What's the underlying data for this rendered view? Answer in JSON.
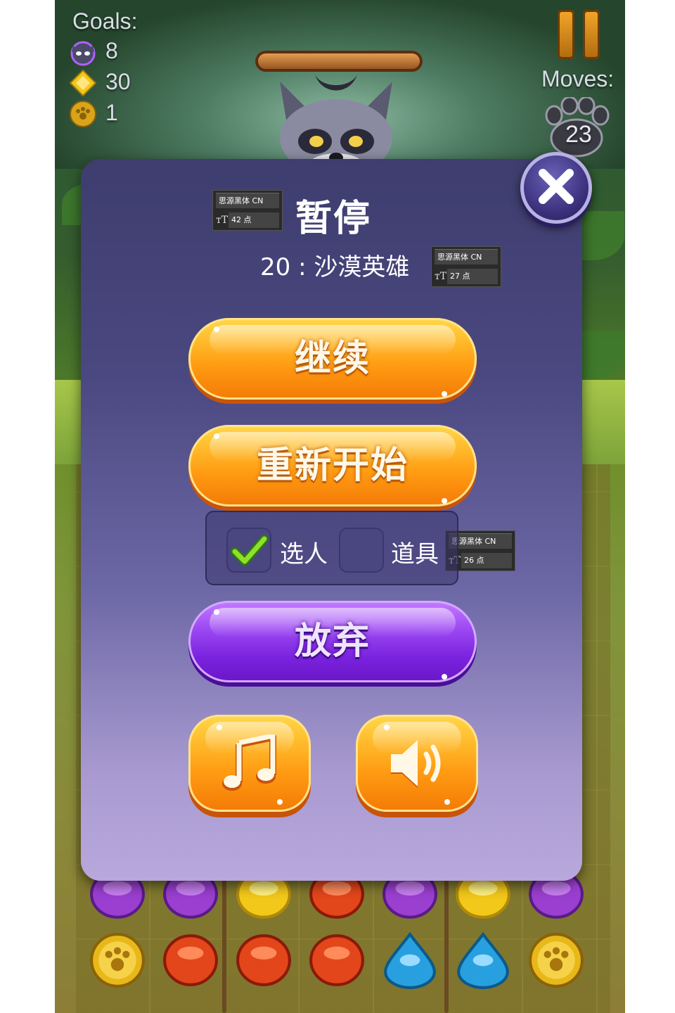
{
  "hud": {
    "goals_label": "Goals:",
    "goals": [
      {
        "icon": "raccoon-head-icon",
        "count": "8"
      },
      {
        "icon": "yellow-diamond-icon",
        "count": "30"
      },
      {
        "icon": "gold-paw-coin-icon",
        "count": "1"
      }
    ],
    "moves_label": "Moves:",
    "moves_count": "23"
  },
  "dialog": {
    "title": "暂停",
    "subtitle": "20 : 沙漠英雄",
    "resume_label": "继续",
    "restart_label": "重新开始",
    "option_select_character": "选人",
    "option_items": "道具",
    "option_select_character_checked": true,
    "option_items_checked": false,
    "quit_label": "放弃",
    "music_icon": "music-note-icon",
    "sound_icon": "speaker-icon"
  },
  "font_annotations": [
    {
      "font": "思源黑体 CN",
      "size": "42 点"
    },
    {
      "font": "思源黑体 CN",
      "size": "27 点"
    },
    {
      "font": "思源黑体 CN",
      "size": "26 点"
    }
  ],
  "colors": {
    "orange_button": "#ff9a12",
    "purple_button": "#7a22de",
    "dialog_top": "#3e3d6e",
    "dialog_bottom": "#b8a8dc"
  }
}
